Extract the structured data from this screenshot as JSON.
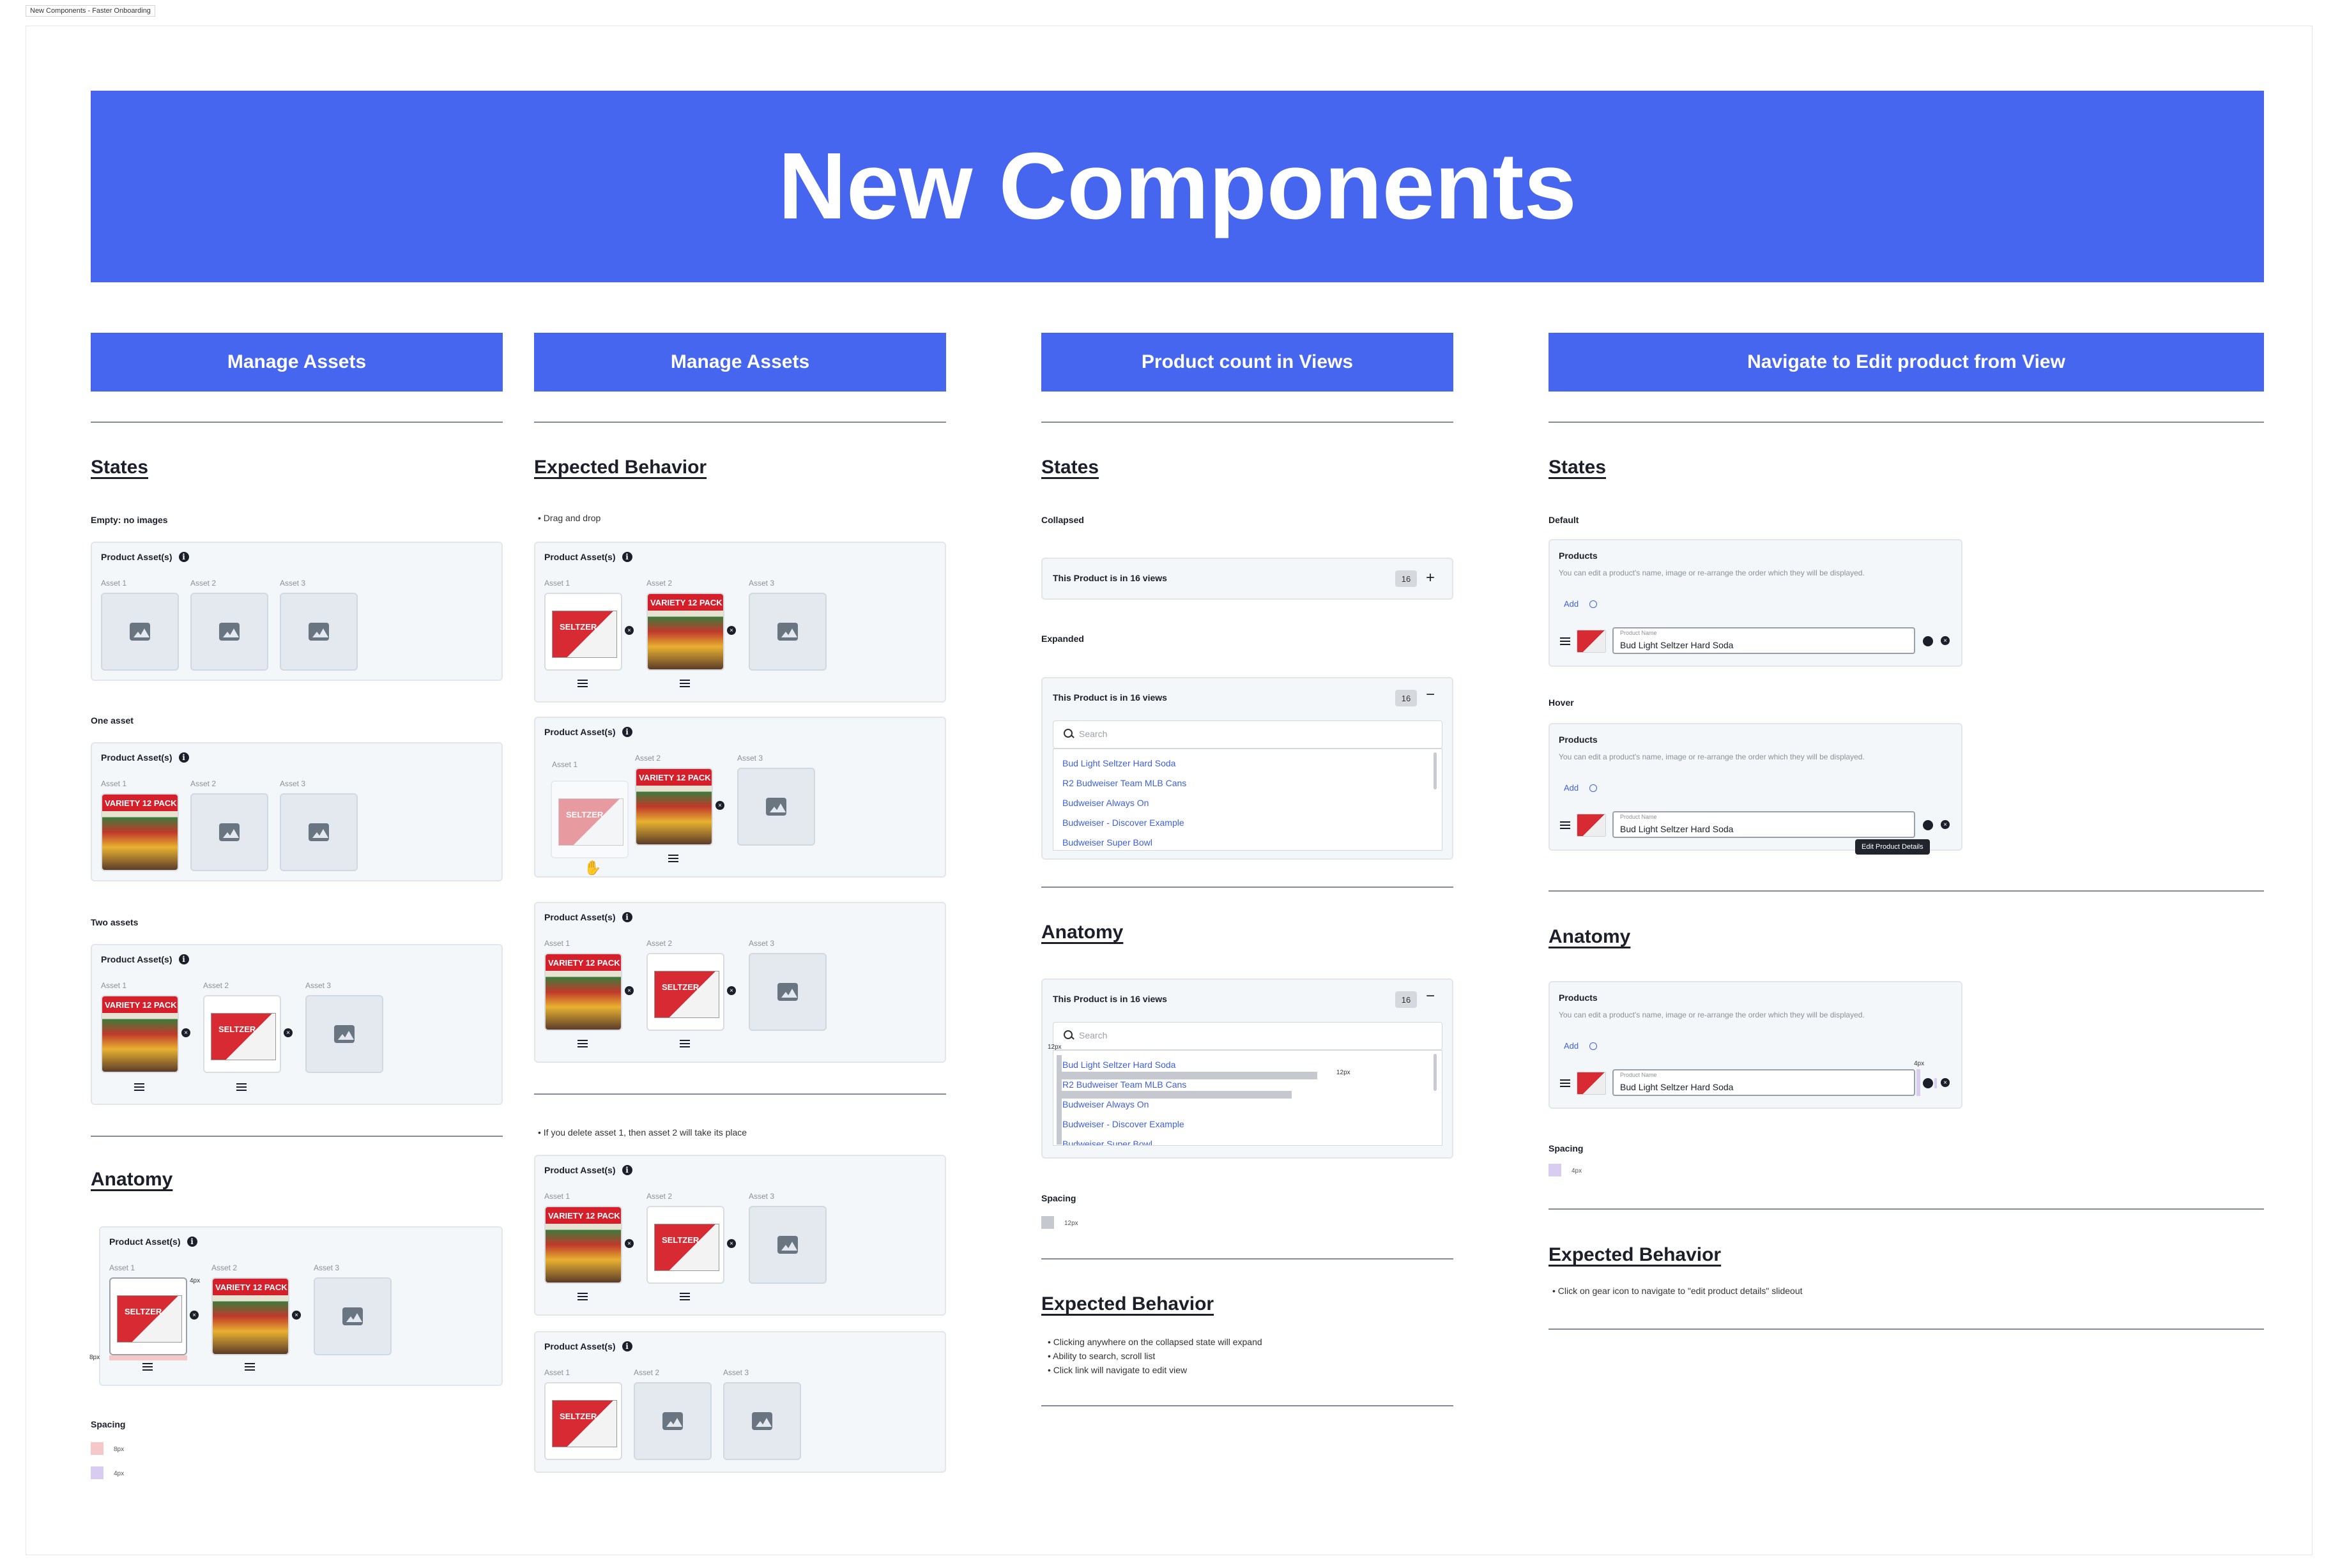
{
  "frame_tab": "New Components - Faster Onboarding",
  "banner_title": "New Components",
  "columns": {
    "c1": "Manage Assets",
    "c2": "Manage Assets",
    "c3": "Product count in Views",
    "c4": "Navigate to Edit product from View"
  },
  "headings": {
    "states": "States",
    "expected": "Expected Behavior",
    "anatomy": "Anatomy"
  },
  "assets": {
    "card_title": "Product Asset(s)",
    "asset1": "Asset 1",
    "asset2": "Asset 2",
    "asset3": "Asset 3",
    "variety": "VARIETY 12 PACK",
    "seltzer": "SELTZER",
    "state_empty": "Empty: no images",
    "state_one": "One asset",
    "state_two": "Two assets",
    "bullet_drag": "Drag and drop",
    "bullet_delete": "If you delete asset 1, then asset 2 will take its place",
    "spacing": "Spacing",
    "sp8": "8px",
    "sp4": "4px"
  },
  "views": {
    "collapsed": "Collapsed",
    "expanded": "Expanded",
    "header": "This Product is in 16 views",
    "count": "16",
    "plus": "+",
    "minus": "−",
    "search_placeholder": "Search",
    "items": [
      "Bud Light Seltzer Hard Soda",
      "R2 Budweiser Team MLB Cans",
      "Budweiser Always On",
      "Budweiser - Discover Example",
      "Budweiser Super Bowl"
    ],
    "spacing": "Spacing",
    "sp12": "12px",
    "behaviors": [
      "Clicking anywhere on the collapsed state will expand",
      "Ability to search, scroll list",
      "Click link will navigate to edit view"
    ]
  },
  "edit": {
    "default": "Default",
    "hover": "Hover",
    "products": "Products",
    "desc": "You can edit a product's name, image or re-arrange the order which they will be displayed.",
    "add": "Add",
    "field_label": "Product Name",
    "field_value": "Bud Light Seltzer Hard Soda",
    "tooltip": "Edit Product Details",
    "spacing": "Spacing",
    "sp4": "4px",
    "behaviors": [
      "Click on gear icon to navigate to \"edit product details\" slideout"
    ]
  },
  "colors": {
    "accent": "#4766f0",
    "link": "#3d5fe0",
    "swatch_pink": "#f4c8c8",
    "swatch_lavender": "#d8cdf0",
    "swatch_grey": "#c5c9cf"
  }
}
